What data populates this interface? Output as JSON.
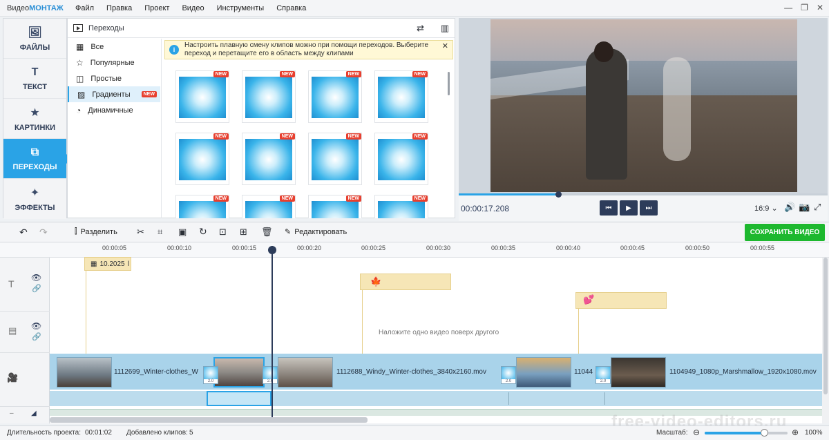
{
  "app": {
    "logo_prefix": "Видео",
    "logo_brand": "МОНТАЖ",
    "menu": [
      "Файл",
      "Правка",
      "Проект",
      "Видео",
      "Инструменты",
      "Справка"
    ]
  },
  "nav": {
    "items": [
      {
        "label": "ФАЙЛЫ",
        "icon": "image-icon"
      },
      {
        "label": "ТЕКСТ",
        "icon": "text-icon"
      },
      {
        "label": "КАРТИНКИ",
        "icon": "star-icon"
      },
      {
        "label": "ПЕРЕХОДЫ",
        "icon": "transitions-icon",
        "active": true
      },
      {
        "label": "ЭФФЕКТЫ",
        "icon": "magic-wand-icon"
      }
    ]
  },
  "panel": {
    "title": "Переходы",
    "categories": [
      "Все",
      "Популярные",
      "Простые",
      "Градиенты",
      "Динамичные"
    ],
    "active_category": "Градиенты",
    "new_badge": "NEW",
    "info_text": "Настроить плавную смену клипов можно при помощи переходов. Выберите переход и перетащите его в область между клипами",
    "close": "✕"
  },
  "player": {
    "time": "00:00:17.208",
    "aspect": "16:9",
    "progress": 0.27
  },
  "toolbar": {
    "split_label": "Разделить",
    "edit_label": "Редактировать",
    "save_label": "СОХРАНИТЬ ВИДЕО"
  },
  "ruler": {
    "ticks": [
      "00:00:05",
      "00:00:10",
      "00:00:15",
      "00:00:20",
      "00:00:25",
      "00:00:30",
      "00:00:35",
      "00:00:40",
      "00:00:45",
      "00:00:50",
      "00:00:55"
    ]
  },
  "timeline": {
    "date_clip": "10.2025",
    "overlay_hint": "Наложите одно видео поверх другого",
    "clips": [
      "1112699_Winter-clothes_W",
      "1112688_Windy_Winter-clothes_3840x2160.mov",
      "11044",
      "1104949_1080p_Marshmallow_1920x1080.mov"
    ],
    "transition_duration": "2.0"
  },
  "status": {
    "duration_label": "Длительность проекта:",
    "duration_value": "00:01:02",
    "clips_label": "Добавлено клипов:",
    "clips_value": "5",
    "scale_label": "Масштаб:",
    "zoom": "100%",
    "zoom_level": 0.72
  },
  "watermark": "free-video-editors.ru",
  "colors": {
    "accent": "#2aa3e6",
    "save": "#1db82e",
    "dark": "#2d3c5a"
  }
}
